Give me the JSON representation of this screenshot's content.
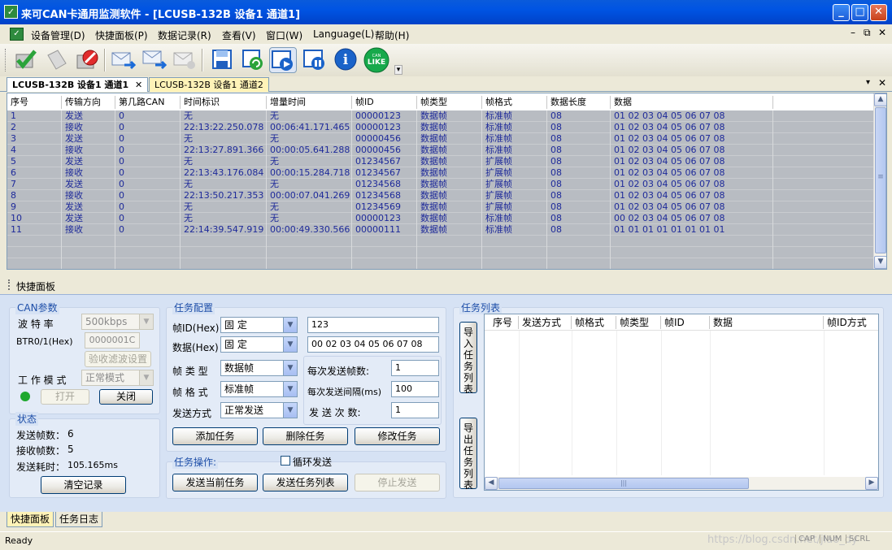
{
  "window": {
    "title": "来可CAN卡通用监测软件 - [LCUSB-132B 设备1 通道1]",
    "minimize": "_",
    "maximize": "□",
    "close": "✕"
  },
  "menu": [
    {
      "label": "设备管理(D)"
    },
    {
      "label": "快捷面板(P)"
    },
    {
      "label": "数据记录(R)"
    },
    {
      "label": "查看(V)"
    },
    {
      "label": "窗口(W)"
    },
    {
      "label": "Language(L)"
    },
    {
      "label": "帮助(H)"
    }
  ],
  "mdi_controls": [
    "–",
    "⧉",
    "✕"
  ],
  "toolbar": {
    "icons": [
      "check-icon",
      "document-icon",
      "stop-icon",
      "mail-send-icon",
      "mail-send-all-icon",
      "mail-disabled-icon",
      "save-icon",
      "refresh-icon",
      "play-icon",
      "pause-icon",
      "info-icon",
      "like-icon"
    ],
    "like_text": "LIKE",
    "can_text": "CAN",
    "info_text": "i",
    "more": "▾"
  },
  "doc_tabs": [
    {
      "label": "LCUSB-132B 设备1 通道1",
      "active": true,
      "close": "✕"
    },
    {
      "label": "LCUSB-132B 设备1 通道2",
      "active": false
    }
  ],
  "doc_tab_controls": [
    "▾",
    "✕"
  ],
  "grid": {
    "columns": [
      "序号",
      "传输方向",
      "第几路CAN",
      "时间标识",
      "增量时间",
      "帧ID",
      "帧类型",
      "帧格式",
      "数据长度",
      "数据"
    ],
    "rows": [
      [
        "1",
        "发送",
        "0",
        "无",
        "无",
        "00000123",
        "数据帧",
        "标准帧",
        "08",
        "01 02 03 04 05 06 07 08"
      ],
      [
        "2",
        "接收",
        "0",
        "22:13:22.250.078",
        "00:06:41.171.465",
        "00000123",
        "数据帧",
        "标准帧",
        "08",
        "01 02 03 04 05 06 07 08"
      ],
      [
        "3",
        "发送",
        "0",
        "无",
        "无",
        "00000456",
        "数据帧",
        "标准帧",
        "08",
        "01 02 03 04 05 06 07 08"
      ],
      [
        "4",
        "接收",
        "0",
        "22:13:27.891.366",
        "00:00:05.641.288",
        "00000456",
        "数据帧",
        "标准帧",
        "08",
        "01 02 03 04 05 06 07 08"
      ],
      [
        "5",
        "发送",
        "0",
        "无",
        "无",
        "01234567",
        "数据帧",
        "扩展帧",
        "08",
        "01 02 03 04 05 06 07 08"
      ],
      [
        "6",
        "接收",
        "0",
        "22:13:43.176.084",
        "00:00:15.284.718",
        "01234567",
        "数据帧",
        "扩展帧",
        "08",
        "01 02 03 04 05 06 07 08"
      ],
      [
        "7",
        "发送",
        "0",
        "无",
        "无",
        "01234568",
        "数据帧",
        "扩展帧",
        "08",
        "01 02 03 04 05 06 07 08"
      ],
      [
        "8",
        "接收",
        "0",
        "22:13:50.217.353",
        "00:00:07.041.269",
        "01234568",
        "数据帧",
        "扩展帧",
        "08",
        "01 02 03 04 05 06 07 08"
      ],
      [
        "9",
        "发送",
        "0",
        "无",
        "无",
        "01234569",
        "数据帧",
        "扩展帧",
        "08",
        "01 02 03 04 05 06 07 08"
      ],
      [
        "10",
        "发送",
        "0",
        "无",
        "无",
        "00000123",
        "数据帧",
        "标准帧",
        "08",
        "00 02 03 04 05 06 07 08"
      ],
      [
        "11",
        "接收",
        "0",
        "22:14:39.547.919",
        "00:00:49.330.566",
        "00000111",
        "数据帧",
        "标准帧",
        "08",
        "01 01 01 01 01 01 01 01"
      ]
    ],
    "scroll_up": "▲",
    "scroll_down": "▼",
    "scroll_grip": "≡"
  },
  "quick_panel_title": "快捷面板",
  "can_params": {
    "title": "CAN参数",
    "baud_label": "波 特 率",
    "baud_value": "500kbps",
    "btr_label": "BTR0/1(Hex)",
    "btr_value": "0000001C",
    "filter_button": "验收滤波设置",
    "mode_label": "工 作 模 式",
    "mode_value": "正常模式",
    "open_button": "打开",
    "close_button": "关闭",
    "status_color": "#1FA82E"
  },
  "status": {
    "title": "状态",
    "sent_label": "发送帧数：",
    "sent_value": "6",
    "recv_label": "接收帧数：",
    "recv_value": "5",
    "time_label": "发送耗时：",
    "time_value": "105.165ms",
    "clear_button": "清空记录"
  },
  "task_config": {
    "title": "任务配置",
    "id_label": "帧ID(Hex)",
    "id_mode": "固  定",
    "id_value": "123",
    "data_label": "数据(Hex)",
    "data_mode": "固  定",
    "data_value": "00 02 03 04 05 06 07 08",
    "type_label": "帧 类 型",
    "type_value": "数据帧",
    "format_label": "帧 格 式",
    "format_value": "标准帧",
    "send_mode_label": "发送方式",
    "send_mode_value": "正常发送",
    "per_send_label": "每次发送帧数:",
    "per_send_value": "1",
    "interval_label": "每次发送间隔(ms)",
    "interval_value": "100",
    "count_label": "发 送 次 数:",
    "count_value": "1",
    "add_button": "添加任务",
    "delete_button": "删除任务",
    "modify_button": "修改任务"
  },
  "task_ops": {
    "title": "任务操作:",
    "loop_label": "循环发送",
    "send_current": "发送当前任务",
    "send_list": "发送任务列表",
    "stop": "停止发送"
  },
  "task_list": {
    "title": "任务列表",
    "import_button": "导入任务列表",
    "export_button": "导出任务列表",
    "columns": [
      "序号",
      "发送方式",
      "帧格式",
      "帧类型",
      "帧ID",
      "数据",
      "帧ID方式"
    ],
    "scroll_left": "◀",
    "scroll_right": "▶",
    "scroll_grip": "|||"
  },
  "bottom_tabs": [
    {
      "label": "快捷面板",
      "active": true
    },
    {
      "label": "任务日志",
      "active": false
    }
  ],
  "statusbar": {
    "text": "Ready",
    "indicators": [
      "CAP",
      "NUM",
      "SCRL"
    ],
    "watermark": "https://blog.csdn.net/jiao_dy"
  },
  "colors": {
    "titlebar": "#0054E3",
    "grid_row": "#B8BCC2",
    "grid_text": "#1E2A9A",
    "panel_bg": "#D6E2F4"
  }
}
